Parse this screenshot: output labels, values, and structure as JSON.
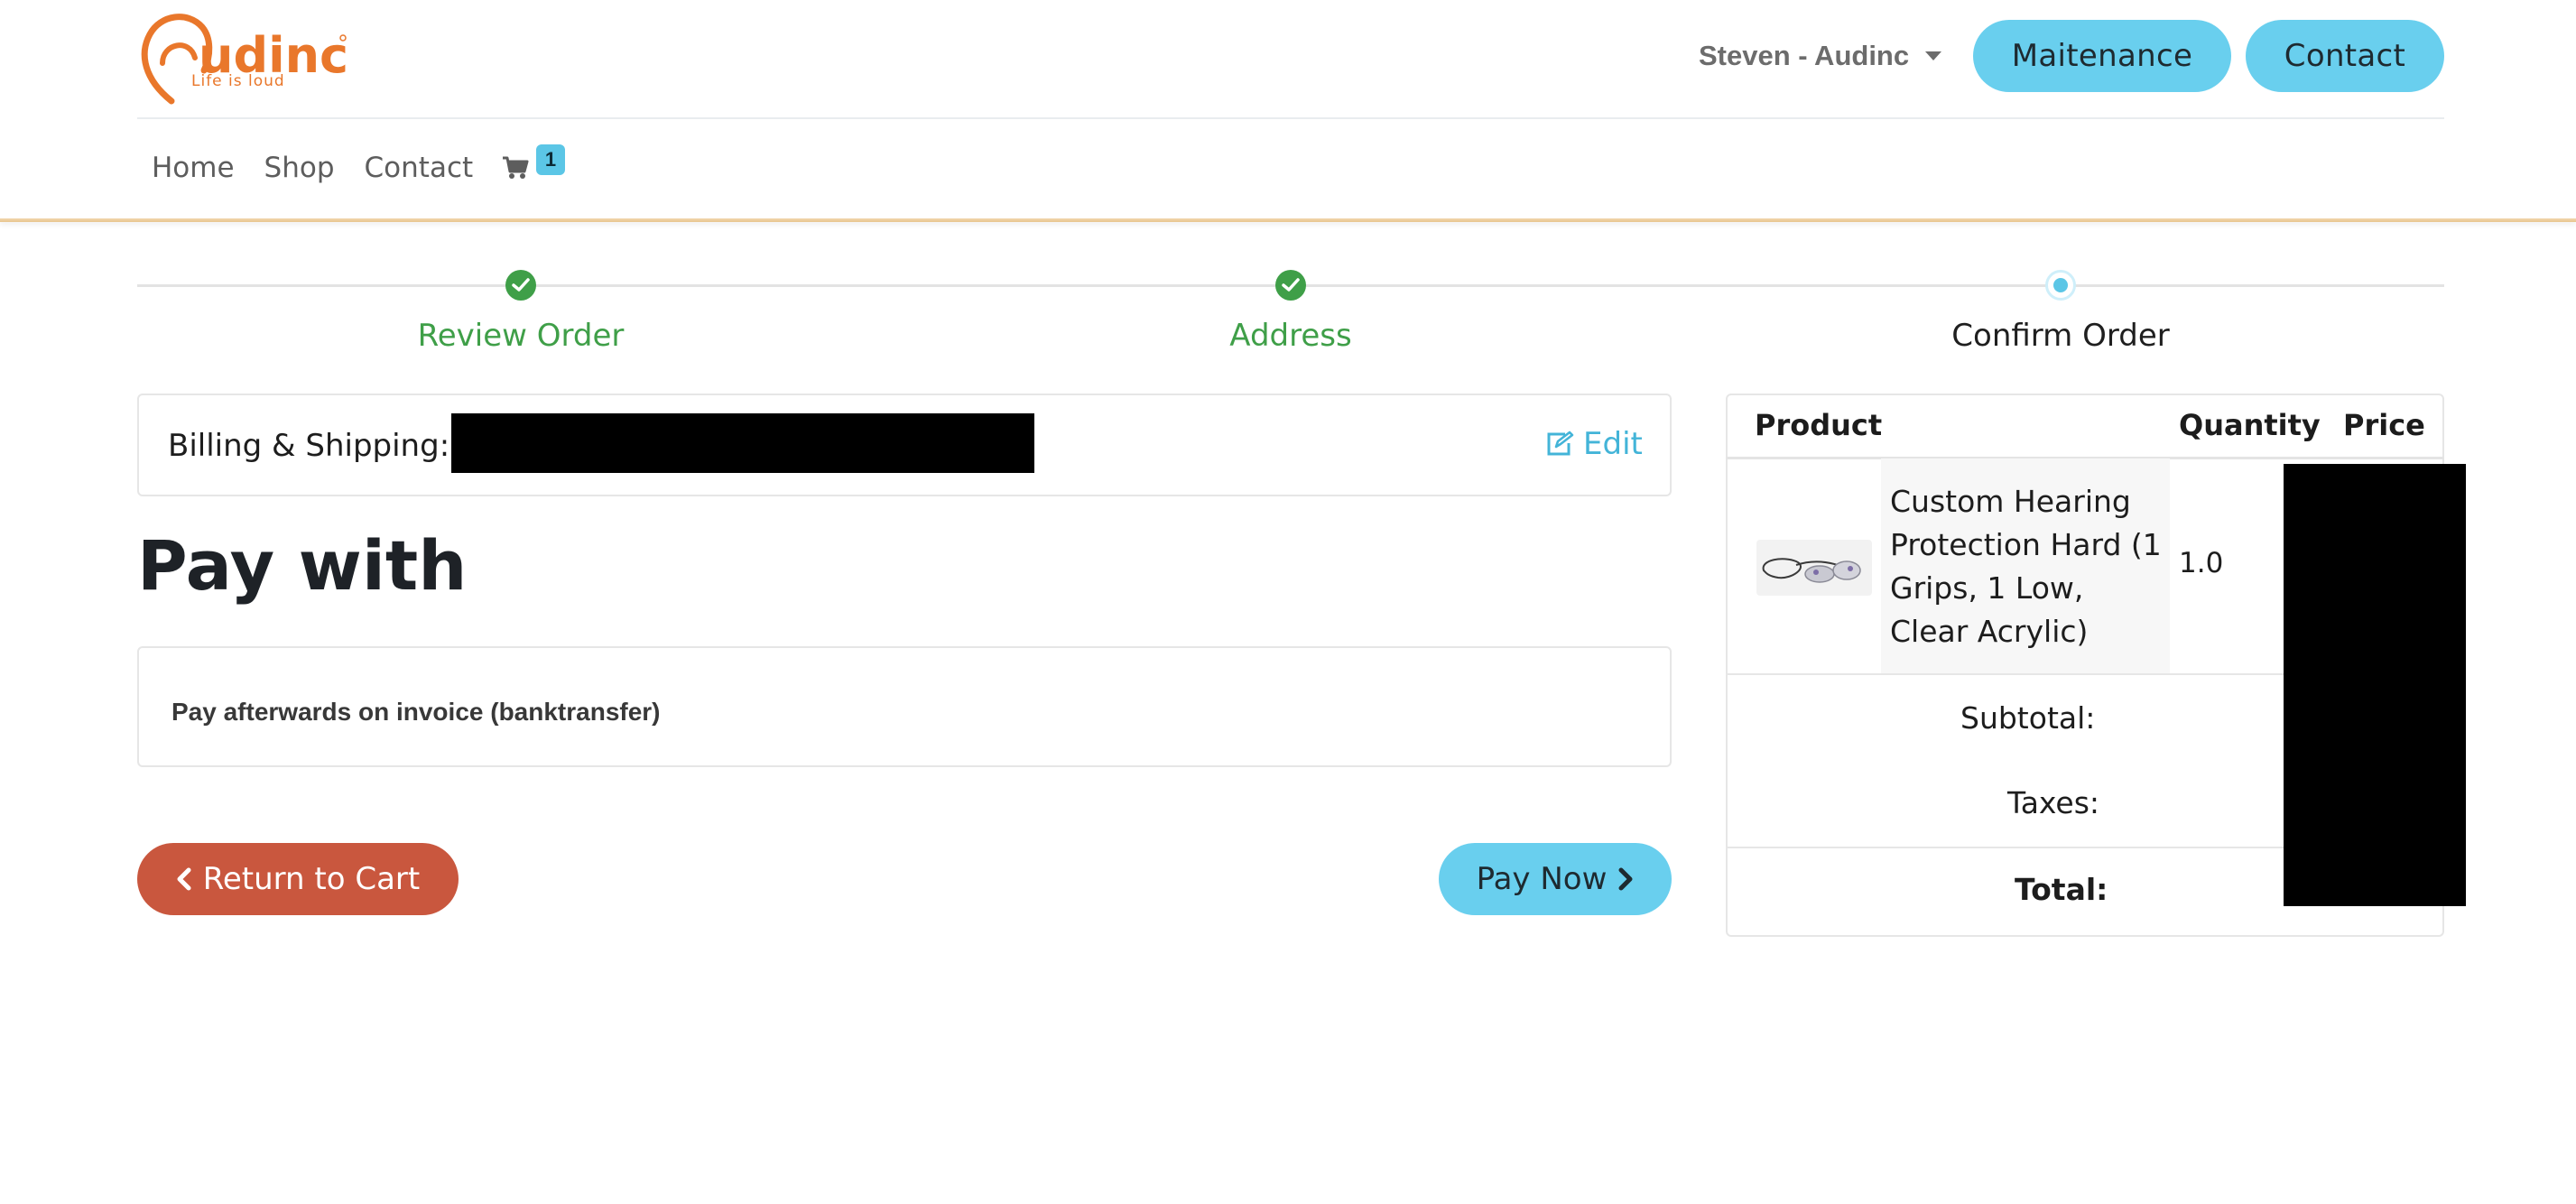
{
  "header": {
    "logo_text": "Audinc",
    "logo_tagline": "Life is loud",
    "user_menu": "Steven - Audinc",
    "maintenance_label": "Maitenance",
    "contact_label": "Contact",
    "brand_color": "#e9772b"
  },
  "nav": {
    "items": [
      "Home",
      "Shop",
      "Contact"
    ],
    "cart_count": "1"
  },
  "progress": {
    "steps": [
      {
        "label": "Review Order",
        "state": "done"
      },
      {
        "label": "Address",
        "state": "done"
      },
      {
        "label": "Confirm Order",
        "state": "current"
      }
    ],
    "done_color": "#3f9f48",
    "current_color": "#5bc6e6"
  },
  "billing": {
    "label": "Billing & Shipping:",
    "edit_label": "Edit"
  },
  "payment": {
    "title": "Pay with",
    "option": "Pay afterwards on invoice (banktransfer)",
    "return_label": "Return to Cart",
    "pay_label": "Pay Now"
  },
  "summary": {
    "headers": {
      "product": "Product",
      "quantity": "Quantity",
      "price": "Price"
    },
    "items": [
      {
        "name": "Custom Hearing Protection Hard (1 Grips, 1 Low, Clear Acrylic)",
        "quantity": "1.0"
      }
    ],
    "subtotal_label": "Subtotal:",
    "taxes_label": "Taxes:",
    "total_label": "Total:"
  }
}
